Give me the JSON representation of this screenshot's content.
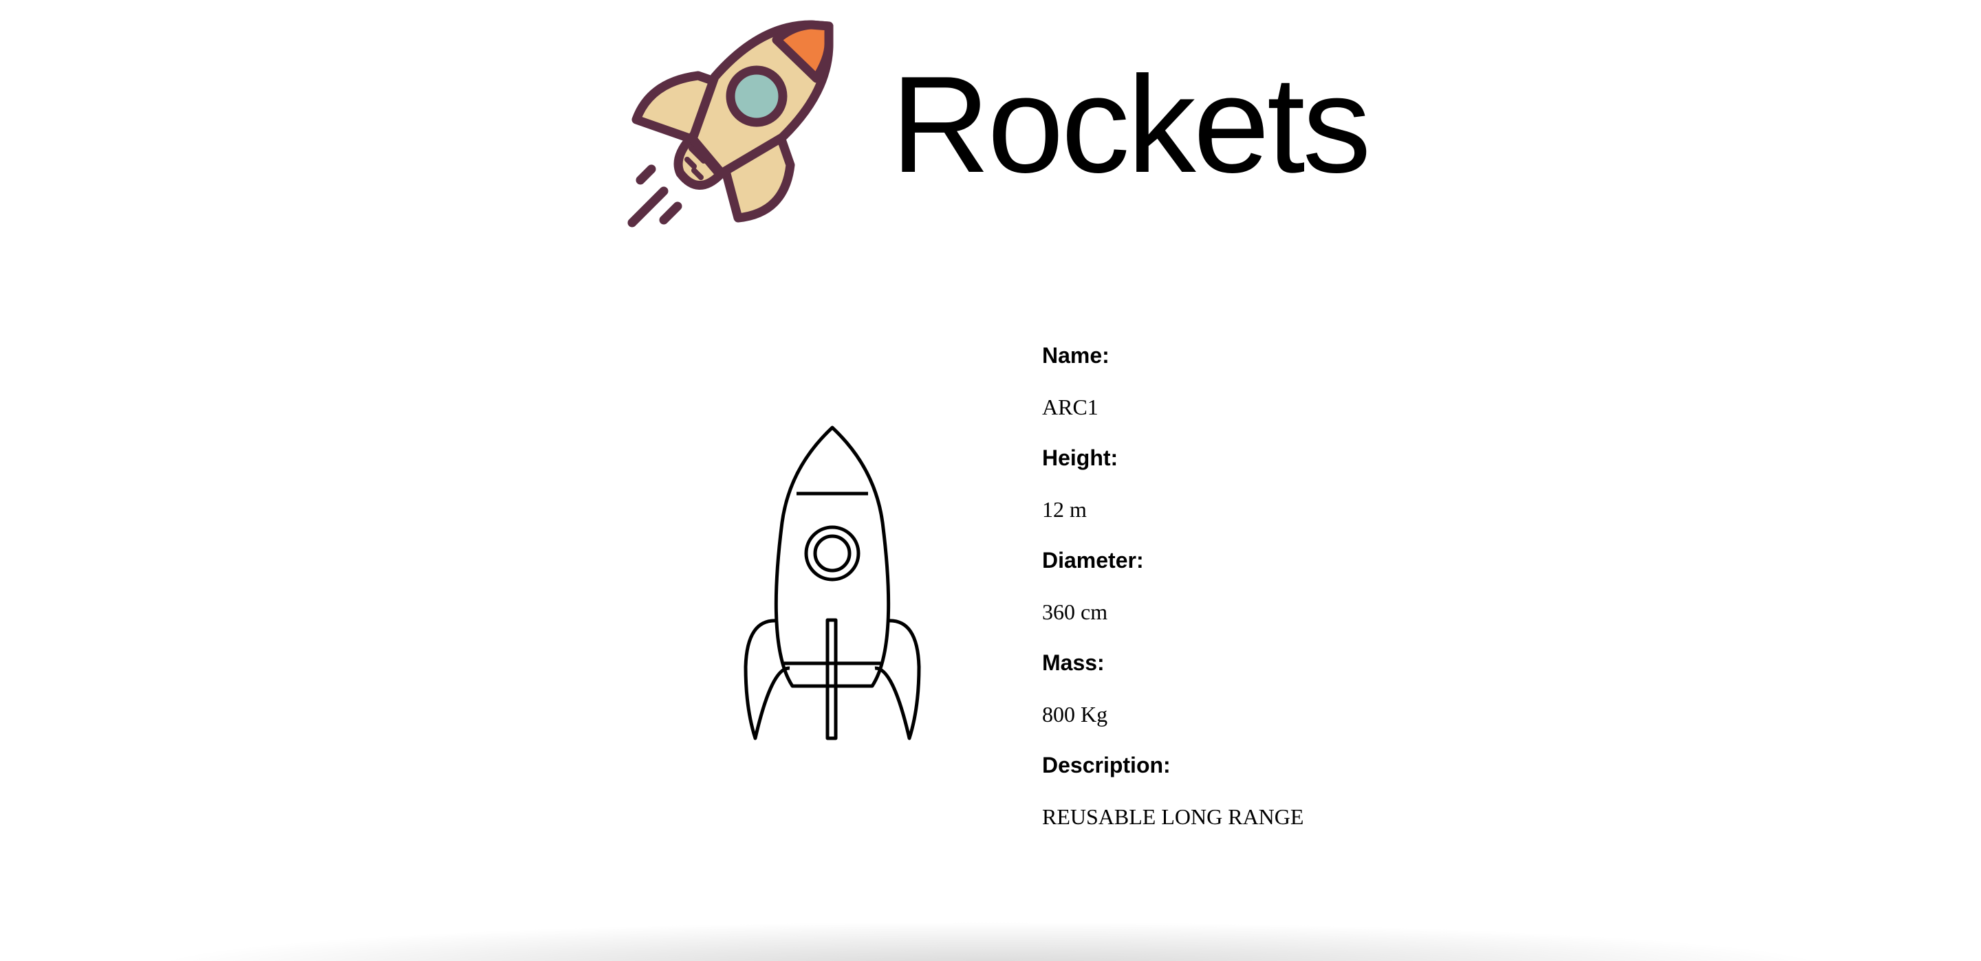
{
  "header": {
    "title": "Rockets",
    "logo_icon": "rocket-logo-icon"
  },
  "rocket": {
    "image_icon": "rocket-outline-icon",
    "fields": [
      {
        "label": "Name:",
        "value": "ARC1"
      },
      {
        "label": "Height:",
        "value": "12 m"
      },
      {
        "label": "Diameter:",
        "value": "360 cm"
      },
      {
        "label": "Mass:",
        "value": "800 Kg"
      },
      {
        "label": "Description:",
        "value": "REUSABLE LONG RANGE"
      }
    ]
  },
  "colors": {
    "logo_outline": "#5b2e43",
    "logo_body": "#ecd29f",
    "logo_window": "#97c4bd",
    "logo_nose": "#f07f3e",
    "background": "#ffffff",
    "text": "#000000"
  }
}
